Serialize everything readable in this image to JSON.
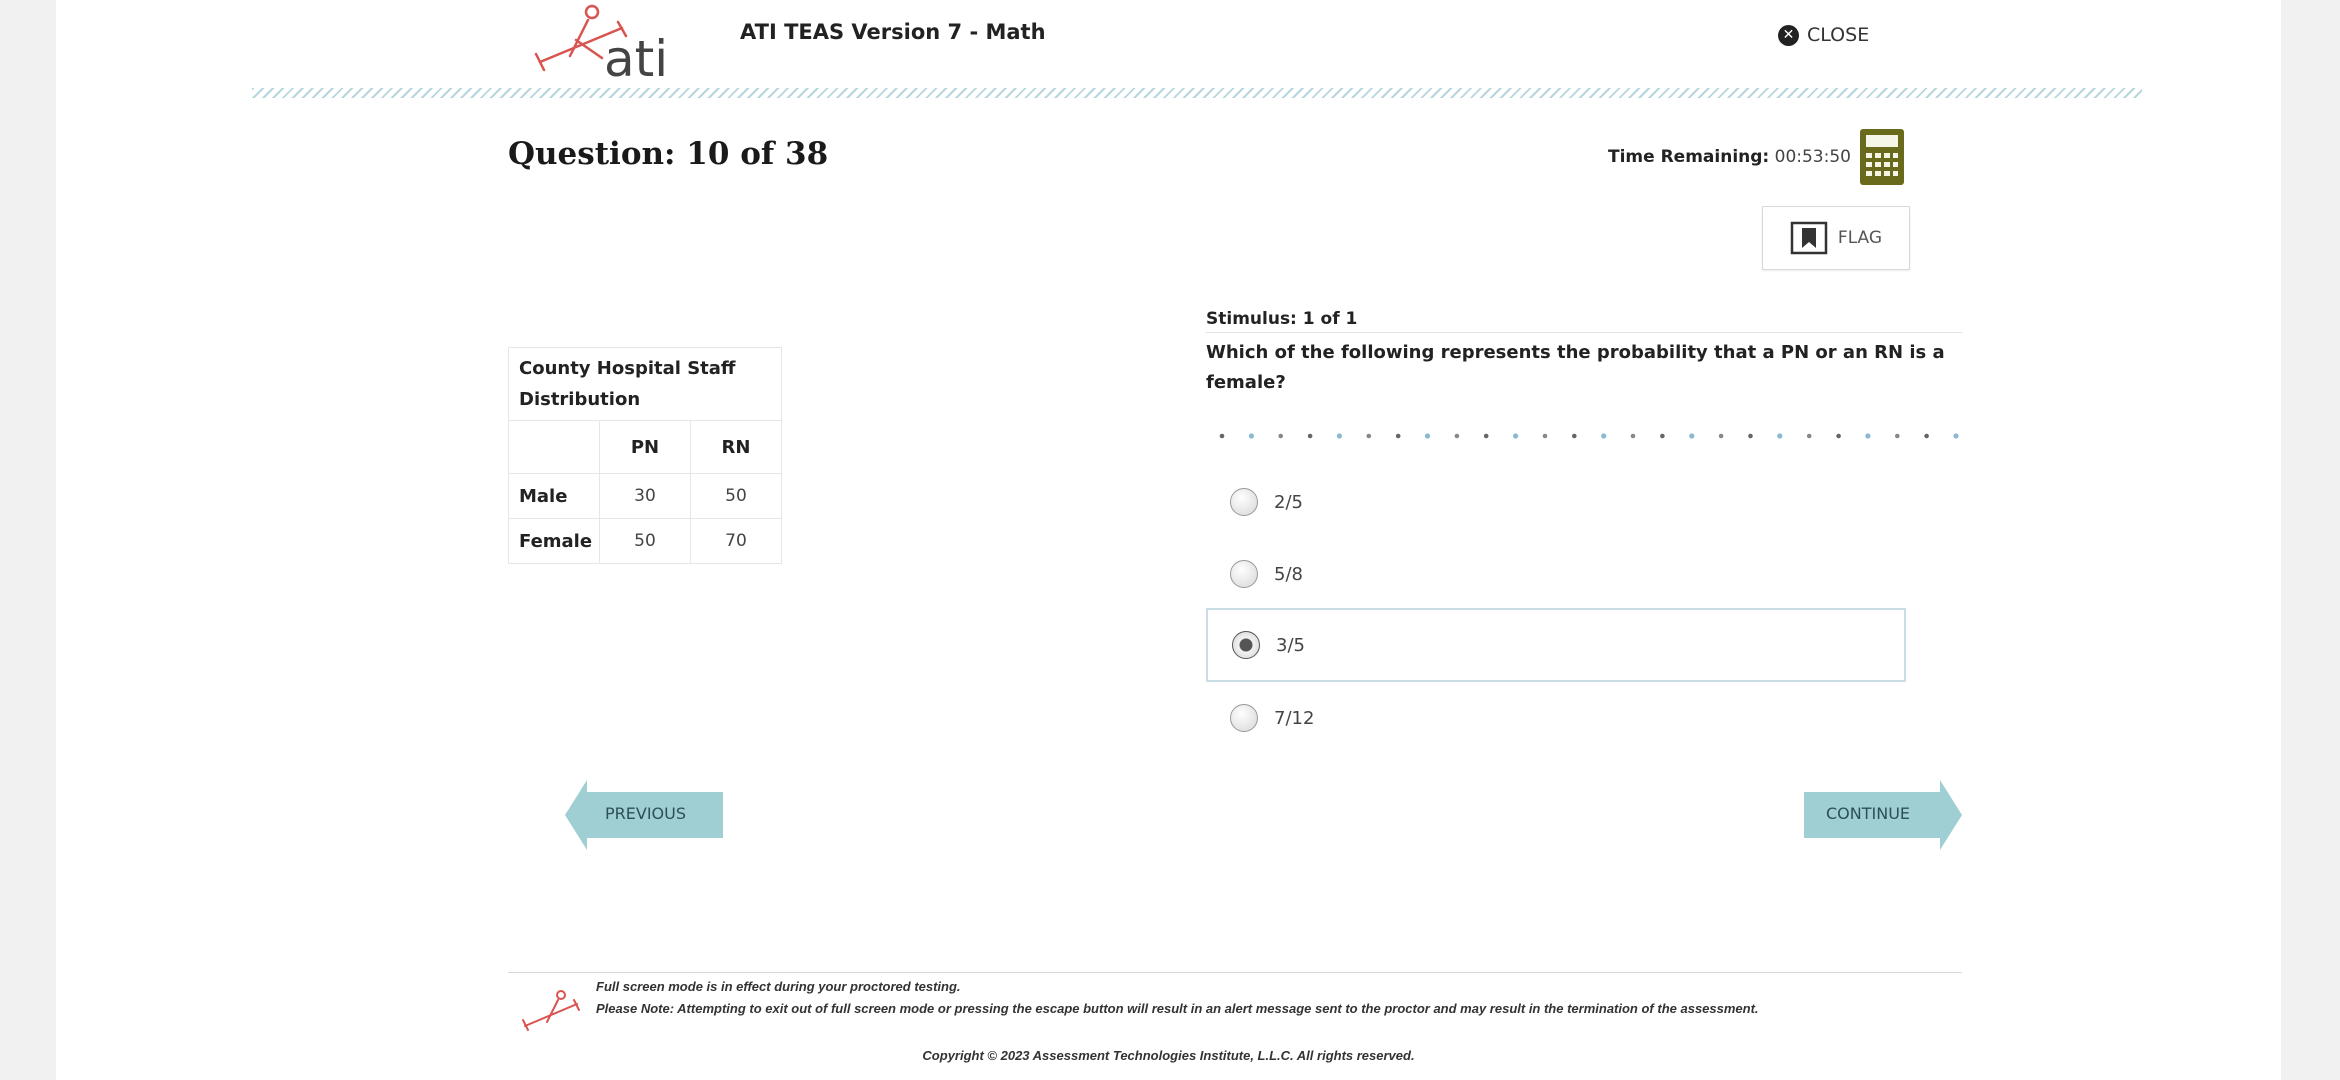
{
  "header": {
    "app_title": "ATI TEAS Version 7 - Math",
    "close_label": "CLOSE",
    "logo_text": "ati"
  },
  "question": {
    "counter": "Question: 10 of 38",
    "time_label": "Time Remaining:",
    "time_value": "00:53:50",
    "flag_label": "FLAG"
  },
  "table": {
    "title": "County Hospital Staff Distribution",
    "columns": [
      "PN",
      "RN"
    ],
    "rows": [
      {
        "label": "Male",
        "values": [
          "30",
          "50"
        ]
      },
      {
        "label": "Female",
        "values": [
          "50",
          "70"
        ]
      }
    ]
  },
  "stimulus": {
    "label": "Stimulus: 1 of 1",
    "question_text": "Which of the following represents the probability that a PN or an RN is a female?"
  },
  "options": [
    {
      "label": "2/5",
      "selected": false
    },
    {
      "label": "5/8",
      "selected": false
    },
    {
      "label": "3/5",
      "selected": true
    },
    {
      "label": "7/12",
      "selected": false
    }
  ],
  "nav": {
    "previous_label": "PREVIOUS",
    "continue_label": "CONTINUE"
  },
  "footer": {
    "line1": "Full screen mode is in effect during your proctored testing.",
    "line2": "Please Note: Attempting to exit out of full screen mode or pressing the escape button will result in an alert message sent to the proctor and may result in the termination of the assessment.",
    "copyright": "Copyright © 2023 Assessment Technologies Institute, L.L.C. All rights reserved."
  },
  "colors": {
    "nav_button": "#9fcfd3",
    "calculator": "#6a6a1c",
    "rule": "#b7d6de",
    "logo_red": "#d9534f"
  }
}
